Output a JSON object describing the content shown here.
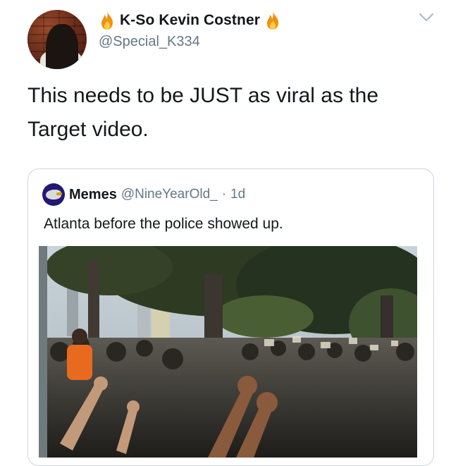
{
  "tweet": {
    "author": {
      "display_name": "K-So Kevin Costner",
      "handle": "@Special_K334",
      "name_emoji": "fire-icon"
    },
    "text": "This needs to be JUST as viral as the Target video."
  },
  "quoted_tweet": {
    "author": {
      "display_name": "Memes",
      "handle": "@NineYearOld_",
      "avatar_icon": "ravens-logo-icon"
    },
    "separator": "·",
    "time": "1d",
    "text": "Atlanta before the police showed up.",
    "media": {
      "type": "video-frame",
      "description_icon": "crowd-raised-fists-image"
    }
  },
  "controls": {
    "more_icon": "chevron-down-icon"
  },
  "colors": {
    "text_primary": "#14171a",
    "text_secondary": "#657786",
    "border": "#ccd6dd",
    "ravens_purple": "#241773"
  }
}
